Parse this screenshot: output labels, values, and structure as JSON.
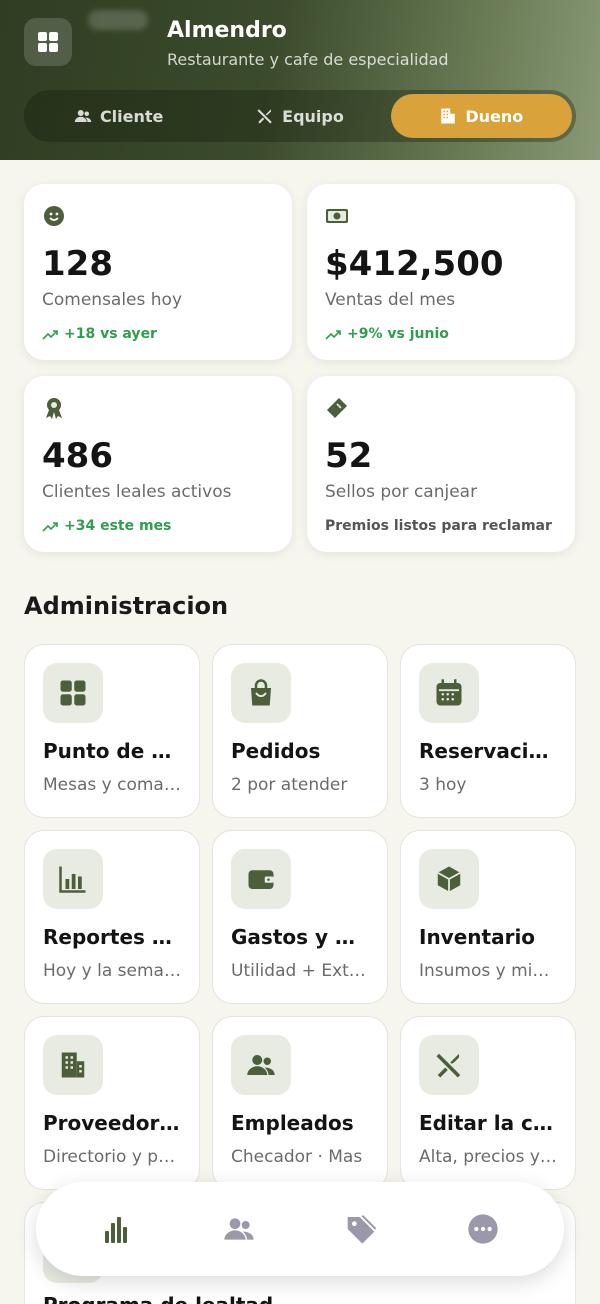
{
  "header": {
    "title": "Almendro",
    "subtitle": "Restaurante y cafe de especialidad",
    "roles": [
      {
        "label": "Cliente",
        "icon": "people-icon",
        "active": false
      },
      {
        "label": "Equipo",
        "icon": "utensils-icon",
        "active": false
      },
      {
        "label": "Dueno",
        "icon": "building-icon",
        "active": true
      }
    ]
  },
  "stats": [
    {
      "icon": "smile-icon",
      "value": "128",
      "label": "Comensales hoy",
      "trend": "+18 vs ayer"
    },
    {
      "icon": "money-icon",
      "value": "$412,500",
      "label": "Ventas del mes",
      "trend": "+9% vs junio"
    },
    {
      "icon": "award-icon",
      "value": "486",
      "label": "Clientes leales activos",
      "trend": "+34 este mes"
    },
    {
      "icon": "ticket-icon",
      "value": "52",
      "label": "Sellos por canjear",
      "note": "Premios listos para reclamar"
    }
  ],
  "admin": {
    "title": "Administracion",
    "tiles": [
      {
        "icon": "grid-icon",
        "name": "Punto de venta",
        "sub": "Mesas y comandas"
      },
      {
        "icon": "bag-icon",
        "name": "Pedidos",
        "sub": "2 por atender"
      },
      {
        "icon": "calendar-icon",
        "name": "Reservaciones",
        "sub": "3 hoy"
      },
      {
        "icon": "bar-chart-icon",
        "name": "Reportes de ventas",
        "sub": "Hoy y la semana"
      },
      {
        "icon": "wallet-icon",
        "name": "Gastos y balance",
        "sub": "Utilidad + Extras"
      },
      {
        "icon": "box-icon",
        "name": "Inventario",
        "sub": "Insumos y minimos"
      },
      {
        "icon": "building-icon",
        "name": "Proveedores",
        "sub": "Directorio y pedidos"
      },
      {
        "icon": "people-icon",
        "name": "Empleados",
        "sub": "Checador · Mas"
      },
      {
        "icon": "utensils-icon",
        "name": "Editar la carta",
        "sub": "Alta, precios y mas"
      }
    ]
  },
  "peek": {
    "text": "Programa de lealtad"
  },
  "nav": [
    {
      "icon": "bar-chart-icon",
      "active": true
    },
    {
      "icon": "people-icon",
      "active": false
    },
    {
      "icon": "tag-icon",
      "active": false
    },
    {
      "icon": "more-icon",
      "active": false
    }
  ],
  "colors": {
    "accent": "#d9a23a",
    "brand_green": "#4d5e3a",
    "trend_green": "#2f9e4e"
  }
}
